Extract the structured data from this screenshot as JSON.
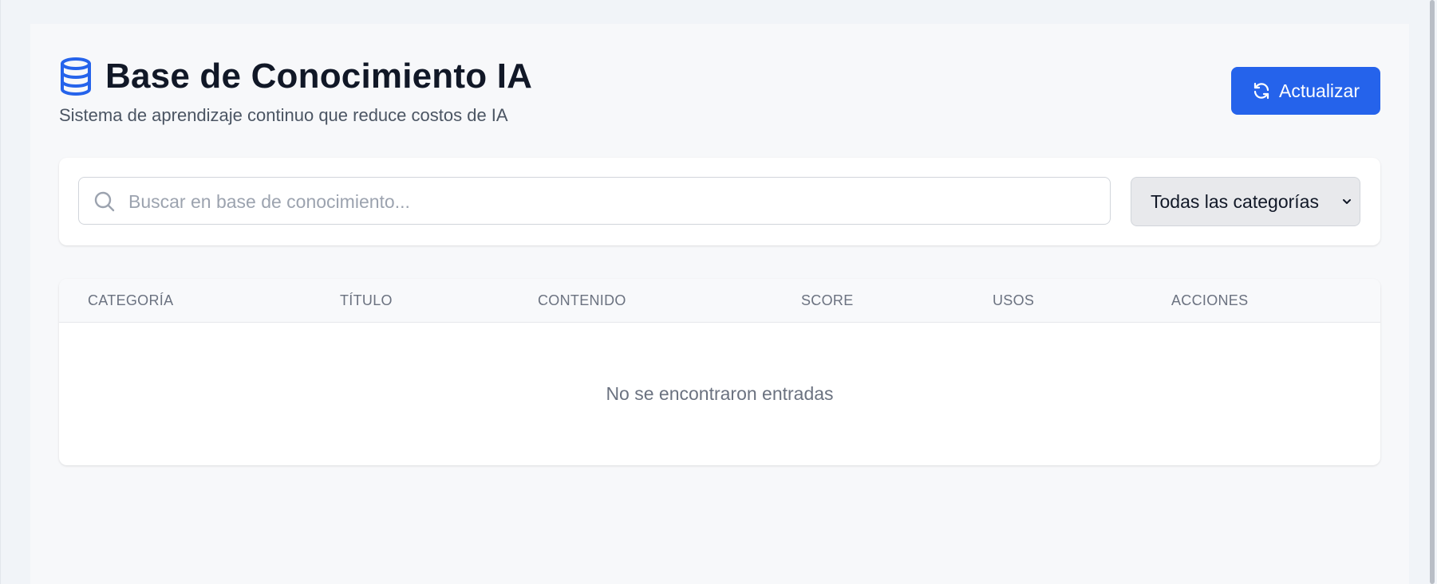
{
  "header": {
    "title": "Base de Conocimiento IA",
    "subtitle": "Sistema de aprendizaje continuo que reduce costos de IA",
    "title_icon": "database-icon"
  },
  "toolbar": {
    "refresh_label": "Actualizar",
    "refresh_icon": "refresh-icon"
  },
  "filters": {
    "search": {
      "placeholder": "Buscar en base de conocimiento...",
      "value": "",
      "icon": "search-icon"
    },
    "category": {
      "selected": "Todas las categorías"
    }
  },
  "table": {
    "columns": [
      "CATEGORÍA",
      "TÍTULO",
      "CONTENIDO",
      "SCORE",
      "USOS",
      "ACCIONES"
    ],
    "rows": [],
    "empty_message": "No se encontraron entradas"
  },
  "colors": {
    "accent": "#2563eb",
    "page_background": "#f1f4f8",
    "card_background": "#ffffff"
  }
}
